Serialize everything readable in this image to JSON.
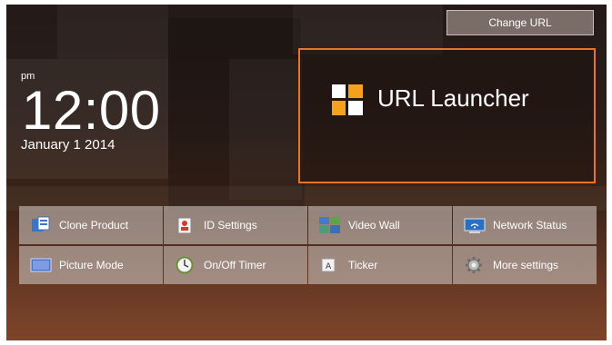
{
  "header": {
    "change_url_label": "Change URL"
  },
  "clock": {
    "ampm": "pm",
    "time": "12:00",
    "date": "January 1 2014"
  },
  "launcher": {
    "label": "URL Launcher"
  },
  "menu": {
    "items": [
      {
        "label": "Clone Product",
        "icon": "clone-product-icon"
      },
      {
        "label": "ID Settings",
        "icon": "id-settings-icon"
      },
      {
        "label": "Video Wall",
        "icon": "video-wall-icon"
      },
      {
        "label": "Network Status",
        "icon": "network-status-icon"
      },
      {
        "label": "Picture Mode",
        "icon": "picture-mode-icon"
      },
      {
        "label": "On/Off Timer",
        "icon": "on-off-timer-icon"
      },
      {
        "label": "Ticker",
        "icon": "ticker-icon"
      },
      {
        "label": "More settings",
        "icon": "gear-icon"
      }
    ]
  },
  "colors": {
    "accent": "#e8732b",
    "tile": "#c8beba"
  }
}
